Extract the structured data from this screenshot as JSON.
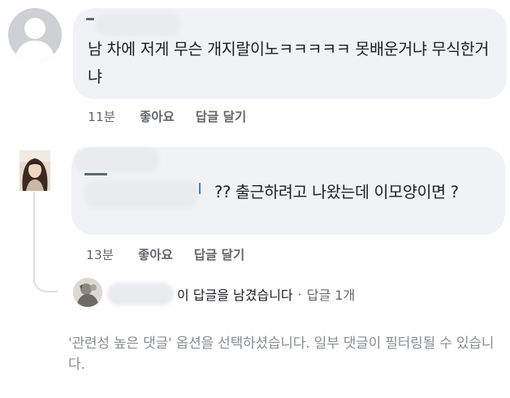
{
  "comments": [
    {
      "text": "남 차에 저게 무슨 개지랄이노ㅋㅋㅋㅋㅋ 못배운거냐 무식한거냐",
      "time": "11분",
      "like_label": "좋아요",
      "reply_label": "답글 달기"
    },
    {
      "text": "?? 출근하려고 나왔는데 이모양이면 ?",
      "time": "13분",
      "like_label": "좋아요",
      "reply_label": "답글 달기"
    }
  ],
  "reply_summary": {
    "text": "이 답글을 남겼습니다",
    "separator": "·",
    "count_label": "답글 1개"
  },
  "notice": "'관련성 높은 댓글' 옵션을 선택하셨습니다. 일부 댓글이 필터링될 수 있습니다."
}
